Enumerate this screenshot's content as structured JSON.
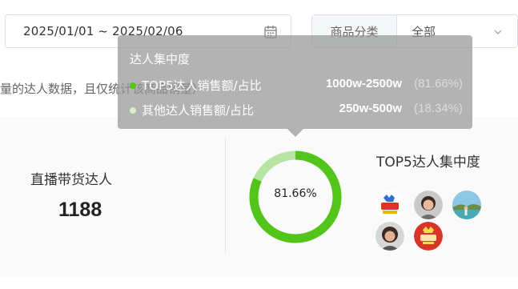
{
  "filters": {
    "date_range": "2025/01/01 ~ 2025/02/06",
    "category_label": "商品分类",
    "category_value": "全部"
  },
  "notice": "量的达人数据，且仅统计该商品销量）",
  "stats": {
    "label": "直播带货达人",
    "value": "1188"
  },
  "concentration": {
    "center_text": "81.66%",
    "title": "TOP5达人集中度",
    "primary_color": "#52c41a",
    "secondary_color": "#b7e4a3"
  },
  "tooltip": {
    "title": "达人集中度",
    "rows": [
      {
        "label": "TOP5达人销售额/占比",
        "range": "1000w-2500w",
        "pct": "(81.66%)",
        "color": "#52c41a"
      },
      {
        "label": "其他达人销售额/占比",
        "range": "250w-500w",
        "pct": "(18.34%)",
        "color": "#d4f0c4"
      }
    ]
  },
  "icons": {
    "calendar": "calendar-icon",
    "chevron": "chevron-down-icon"
  }
}
